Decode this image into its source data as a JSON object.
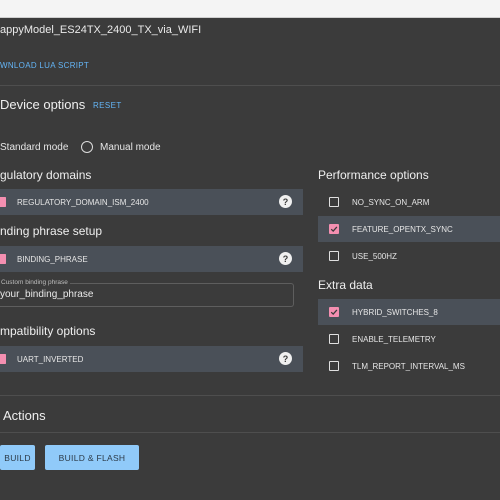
{
  "header": {
    "target_title": "appyModel_ES24TX_2400_TX_via_WIFI",
    "download_lua_label": "WNLOAD LUA SCRIPT"
  },
  "device_options": {
    "title": "Device options",
    "reset_label": "RESET",
    "modes": [
      {
        "label": "Standard mode",
        "selected": true
      },
      {
        "label": "Manual mode",
        "selected": false
      }
    ]
  },
  "regulatory_domains": {
    "title": "gulatory domains",
    "option": {
      "label": "REGULATORY_DOMAIN_ISM_2400",
      "checked": true
    }
  },
  "binding_phrase": {
    "title": "nding phrase setup",
    "option": {
      "label": "BINDING_PHRASE",
      "checked": true
    },
    "field_label": "Custom binding phrase",
    "field_value": "your_binding_phrase"
  },
  "compatibility": {
    "title": "mpatibility options",
    "option": {
      "label": "UART_INVERTED",
      "checked": true
    }
  },
  "performance": {
    "title": "Performance options",
    "options": [
      {
        "label": "NO_SYNC_ON_ARM",
        "checked": false
      },
      {
        "label": "FEATURE_OPENTX_SYNC",
        "checked": true
      },
      {
        "label": "USE_500HZ",
        "checked": false
      }
    ]
  },
  "extra_data": {
    "title": "Extra data",
    "options": [
      {
        "label": "HYBRID_SWITCHES_8",
        "checked": true
      },
      {
        "label": "ENABLE_TELEMETRY",
        "checked": false
      },
      {
        "label": "TLM_REPORT_INTERVAL_MS",
        "checked": false
      }
    ]
  },
  "actions": {
    "title": "Actions",
    "build_label": "BUILD",
    "build_flash_label": "BUILD & FLASH"
  },
  "colors": {
    "background": "#3b3b3b",
    "highlight_row": "#4a5058",
    "checkbox_checked": "#f48fb1",
    "link": "#64b5f6",
    "button": "#90caf9"
  }
}
